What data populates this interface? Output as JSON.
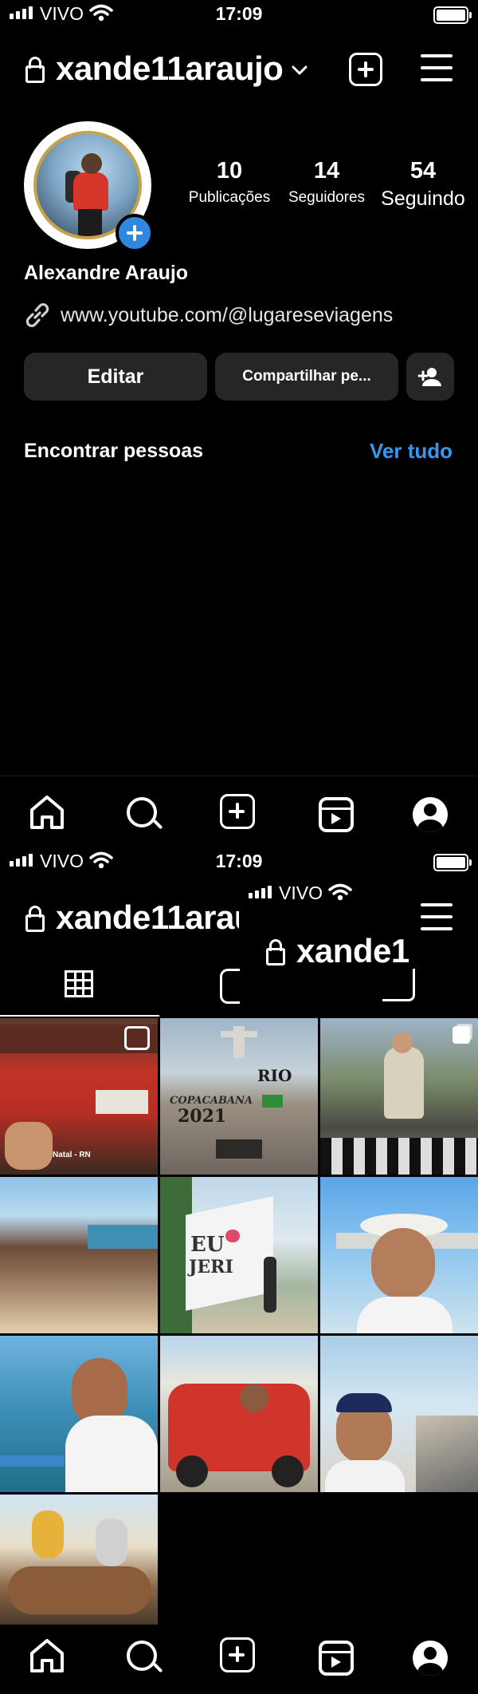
{
  "status_top": {
    "carrier": "VIVO",
    "time": "17:09"
  },
  "status_bottom": {
    "carrier": "VIVO",
    "time": "17:09"
  },
  "status_overlay": {
    "carrier": "VIVO"
  },
  "header": {
    "username": "xande11araujo",
    "username_truncated": "xande11arau",
    "username_overlay": "xande1"
  },
  "profile": {
    "name": "Alexandre Araujo",
    "link": "www.youtube.com/@lugareseviagens",
    "stats": [
      {
        "value": "10",
        "label": "Publicações"
      },
      {
        "value": "14",
        "label": "Seguidores"
      },
      {
        "value": "54",
        "label": "Seguindo"
      }
    ]
  },
  "actions": {
    "edit": "Editar",
    "share": "Compartilhar pe..."
  },
  "discover": {
    "title": "Encontrar pessoas",
    "see_all": "Ver tudo"
  },
  "posts": [
    {
      "id": "truck",
      "caption": "Natal - RN",
      "type": "reel"
    },
    {
      "id": "copacabana",
      "caption_a": "COPACABANA",
      "caption_b": "2021",
      "caption_c": "RIO",
      "type": "photo"
    },
    {
      "id": "statue",
      "type": "carousel"
    },
    {
      "id": "beach-rocks",
      "type": "photo"
    },
    {
      "id": "eu-jeri",
      "caption_a": "EU",
      "caption_b": "JERI",
      "type": "photo"
    },
    {
      "id": "hat-selfie",
      "type": "photo"
    },
    {
      "id": "boat-selfie",
      "type": "photo"
    },
    {
      "id": "buggy",
      "type": "photo"
    },
    {
      "id": "pier-selfie",
      "type": "photo"
    },
    {
      "id": "camel",
      "type": "photo"
    }
  ],
  "nav": [
    "home-icon",
    "search-icon",
    "create-icon",
    "reels-icon",
    "profile-icon"
  ]
}
